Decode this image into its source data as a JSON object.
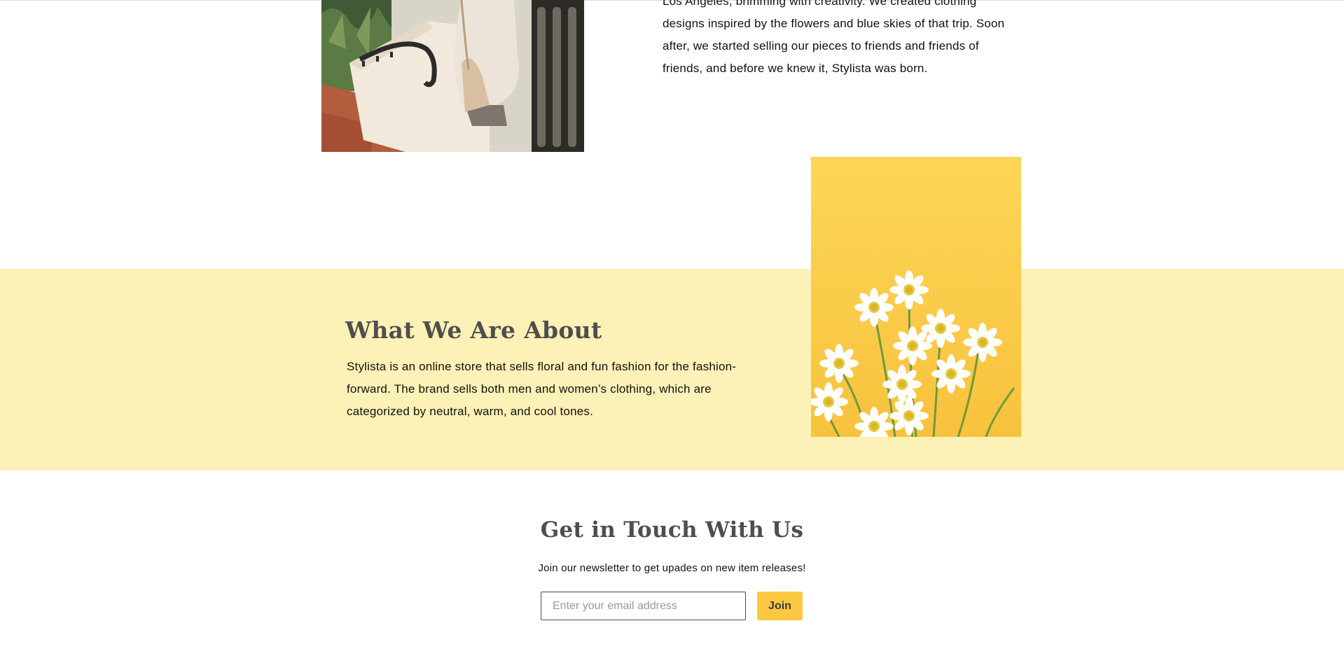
{
  "story": {
    "text": "Los Angeles, brimming with creativity. We created clothing designs inspired by the flowers and blue skies of that trip. Soon after, we started selling our pieces to friends and friends of friends, and before we knew it, Stylista was born."
  },
  "about": {
    "title": "What We Are About",
    "text": "Stylista is an online store that sells floral and fun fashion for the fashion-forward. The brand sells both men and women’s clothing, which are categorized by neutral, warm, and cool tones."
  },
  "contact": {
    "title": "Get in Touch With Us",
    "subtitle": "Join our newsletter to get upades on new item releases!",
    "email_placeholder": "Enter your email address",
    "join_label": "Join"
  },
  "colors": {
    "band": "#fcf1b6",
    "accent": "#fcc842",
    "heading": "#4e4e4e"
  }
}
